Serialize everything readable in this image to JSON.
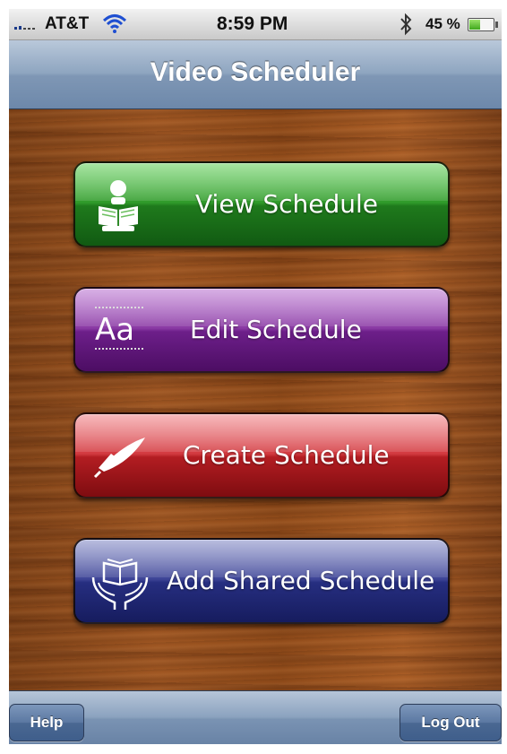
{
  "status_bar": {
    "carrier": "AT&T",
    "time": "8:59 PM",
    "battery_text": "45 %",
    "battery_level": 0.45,
    "icons": [
      "signal-bars-icon",
      "wifi-icon",
      "bluetooth-icon",
      "battery-icon"
    ]
  },
  "nav": {
    "title": "Video Scheduler"
  },
  "menu": [
    {
      "label": "View Schedule",
      "icon": "reader-icon",
      "color": "#2f9a2a"
    },
    {
      "label": "Edit Schedule",
      "icon": "font-aa-icon",
      "icon_text": "Aa",
      "color": "#7a2a96"
    },
    {
      "label": "Create Schedule",
      "icon": "quill-icon",
      "color": "#c4262c"
    },
    {
      "label": "Add Shared Schedule",
      "icon": "hands-book-icon",
      "color": "#2a3186"
    }
  ],
  "toolbar": {
    "help_label": "Help",
    "logout_label": "Log Out"
  },
  "colors": {
    "nav_blue": "#7f97b5",
    "wood": "#8a4718"
  }
}
